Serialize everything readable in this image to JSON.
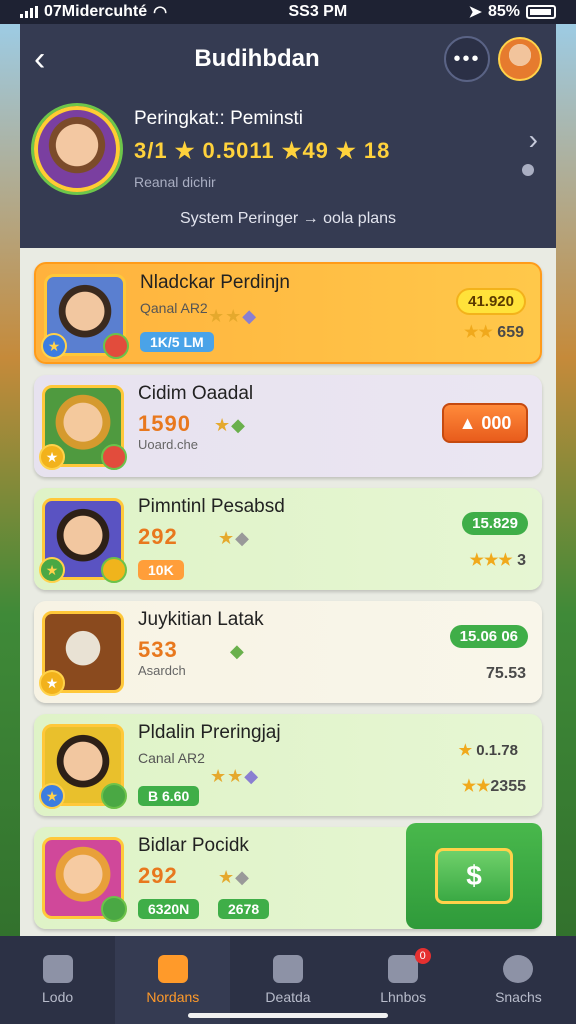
{
  "status_bar": {
    "carrier": "07Midercuhté",
    "time": "SS3 PM",
    "battery": "85%"
  },
  "header": {
    "title": "Budihbdan"
  },
  "profile": {
    "name": "Peringkat:: Peminsti",
    "stats": "3/1 ★ 0.5011 ★49 ★ 18",
    "sub": "Reanal dichir",
    "note": "System Peringer → oola plans"
  },
  "cards": [
    {
      "name": "Nladckar Perdinjn",
      "sub": "Qanal AR2",
      "pill": "1K/5 LM",
      "right_top": "41.920",
      "right_bottom": "659"
    },
    {
      "name": "Cidim Oaadal",
      "score": "1590",
      "sub": "Uoard.che",
      "action": "000"
    },
    {
      "name": "Pimntinl Pesabsd",
      "score": "292",
      "pill": "10K",
      "right_top": "15.829",
      "right_bottom": "3"
    },
    {
      "name": "Juykitian Latak",
      "score": "533",
      "sub": "Asardch",
      "right_top": "15.06 06",
      "right_bottom": "75.53"
    },
    {
      "name": "Pldalin Preringjaj",
      "sub": "Canal AR2",
      "pill": "B 6.60",
      "right_top": "0.1.78",
      "right_bottom": "2355"
    },
    {
      "name": "Bidlar Pocidk",
      "score": "292",
      "pill": "6320N",
      "pill2": "2678",
      "action": "$"
    }
  ],
  "nav": [
    {
      "label": "Lodo"
    },
    {
      "label": "Nordans"
    },
    {
      "label": "Deatda"
    },
    {
      "label": "Lhnbos",
      "badge": "0"
    },
    {
      "label": "Snachs"
    }
  ]
}
